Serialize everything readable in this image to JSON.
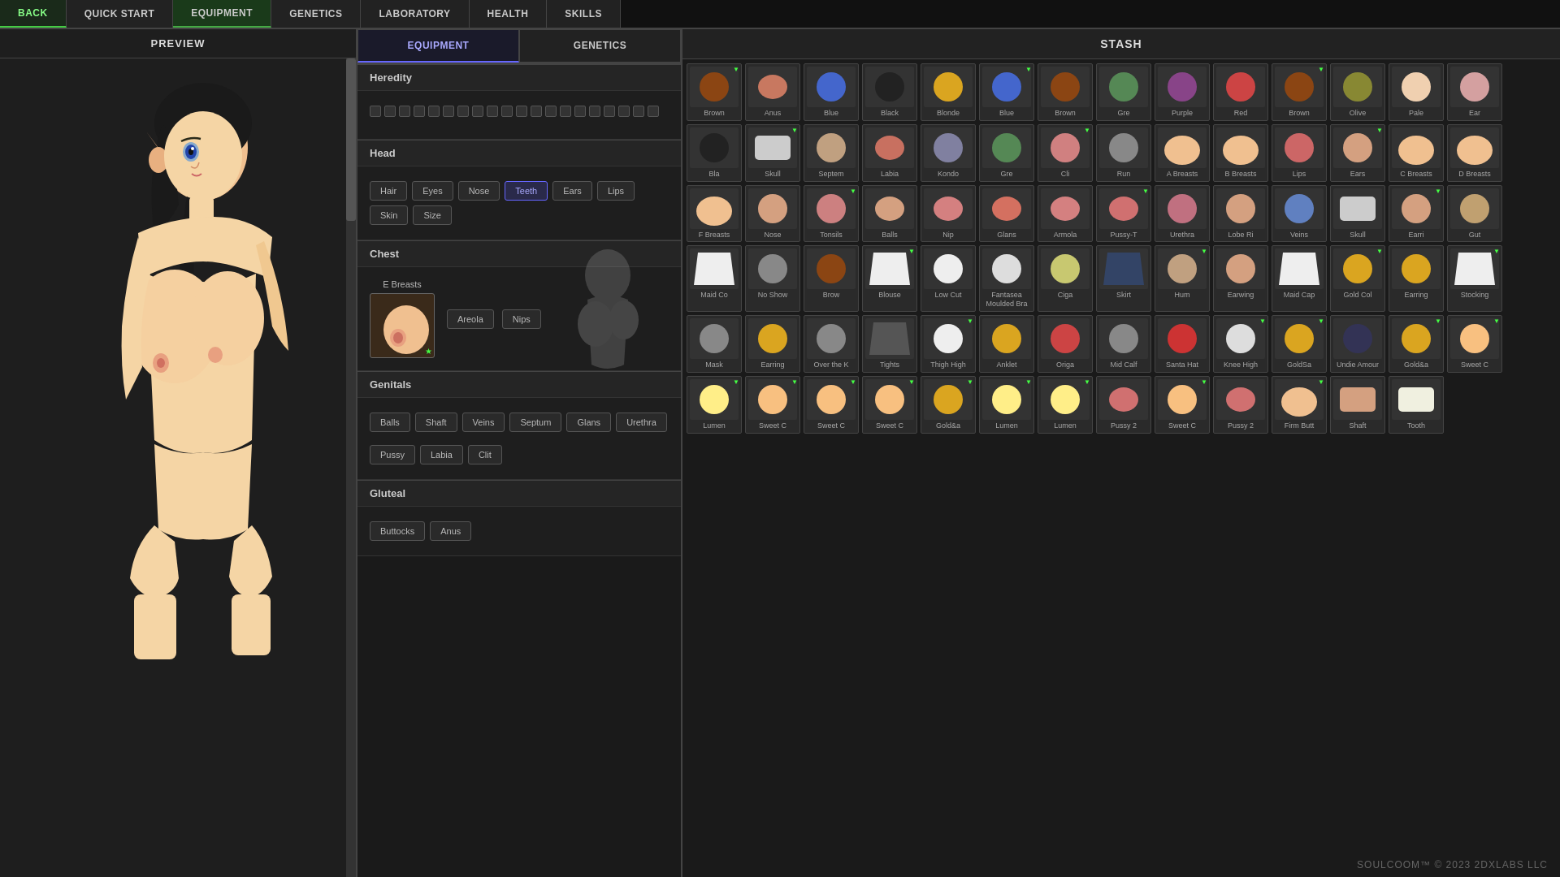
{
  "nav": {
    "back": "BACK",
    "items": [
      "QUICK START",
      "EQUIPMENT",
      "GENETICS",
      "LABORATORY",
      "HEALTH",
      "SKILLS"
    ],
    "active": "EQUIPMENT"
  },
  "preview": {
    "title": "PREVIEW"
  },
  "equipment": {
    "tab_equipment": "EQUIPMENT",
    "tab_genetics": "GENETICS",
    "sections": {
      "heredity": "Heredity",
      "head": "Head",
      "chest": "Chest",
      "genitals": "Genitals",
      "gluteal": "Gluteal"
    },
    "head_tags": [
      "Hair",
      "Eyes",
      "Nose",
      "Teeth",
      "Ears",
      "Lips",
      "Skin",
      "Size"
    ],
    "chest_item": "E Breasts",
    "chest_nips": [
      "Areola",
      "Nips"
    ],
    "genital_tags": [
      "Balls",
      "Shaft",
      "Veins",
      "Septum",
      "Glans",
      "Urethra",
      "Pussy",
      "Labia",
      "Clit"
    ],
    "gluteal_tags": [
      "Buttocks",
      "Anus"
    ]
  },
  "stash": {
    "title": "Stash",
    "items": [
      {
        "label": "Brown",
        "color": "#8B4513"
      },
      {
        "label": "Anus",
        "color": "#c87860"
      },
      {
        "label": "Blue",
        "color": "#4466cc"
      },
      {
        "label": "Black",
        "color": "#222"
      },
      {
        "label": "Blonde",
        "color": "#daa520"
      },
      {
        "label": "Blue",
        "color": "#4466cc"
      },
      {
        "label": "Brown",
        "color": "#8B4513"
      },
      {
        "label": "Gre",
        "color": "#558855"
      },
      {
        "label": "Purple",
        "color": "#884488"
      },
      {
        "label": "Red",
        "color": "#cc4444"
      },
      {
        "label": "Brown",
        "color": "#8B4513"
      },
      {
        "label": "Olive",
        "color": "#888833"
      },
      {
        "label": "Pale",
        "color": "#f0d0b0"
      },
      {
        "label": "Ear",
        "color": "#d4a0a0"
      },
      {
        "label": "Bla",
        "color": "#222"
      },
      {
        "label": "Skull",
        "color": "#ccc"
      },
      {
        "label": "Septem",
        "color": "#c0a080"
      },
      {
        "label": "Labia",
        "color": "#c87060"
      },
      {
        "label": "Kondo",
        "color": "#8080a0"
      },
      {
        "label": "Gre",
        "color": "#558855"
      },
      {
        "label": "Cli",
        "color": "#d08080"
      },
      {
        "label": "Run",
        "color": "#888"
      },
      {
        "label": "A Breasts",
        "color": "#f0c090"
      },
      {
        "label": "B Breasts",
        "color": "#f0c090"
      },
      {
        "label": "Lips",
        "color": "#cc6666"
      },
      {
        "label": "Ears",
        "color": "#d4a080"
      },
      {
        "label": "C Breasts",
        "color": "#f0c090"
      },
      {
        "label": "D Breasts",
        "color": "#f0c090"
      },
      {
        "label": "F Breasts",
        "color": "#f0c090"
      },
      {
        "label": "Nose",
        "color": "#d4a080"
      },
      {
        "label": "Tonsils",
        "color": "#cc8080"
      },
      {
        "label": "Balls",
        "color": "#d4a080"
      },
      {
        "label": "Nip",
        "color": "#d48080"
      },
      {
        "label": "Glans",
        "color": "#d47060"
      },
      {
        "label": "Armola",
        "color": "#d48080"
      },
      {
        "label": "Pussy-T",
        "color": "#d07070"
      },
      {
        "label": "Urethra",
        "color": "#c07080"
      },
      {
        "label": "Lobe Ri",
        "color": "#d4a080"
      },
      {
        "label": "Veins",
        "color": "#6080c0"
      },
      {
        "label": "Skull",
        "color": "#ccc"
      },
      {
        "label": "Earri",
        "color": "#d4a080"
      },
      {
        "label": "Gut",
        "color": "#c0a070"
      },
      {
        "label": "Maid Co",
        "color": "#eee"
      },
      {
        "label": "No Show",
        "color": "#888"
      },
      {
        "label": "Brow",
        "color": "#8B4513"
      },
      {
        "label": "Blouse",
        "color": "#eee"
      },
      {
        "label": "Low Cut",
        "color": "#eee"
      },
      {
        "label": "Fantasea Moulded Bra",
        "color": "#ddd"
      },
      {
        "label": "Ciga",
        "color": "#c8c870"
      },
      {
        "label": "Skirt",
        "color": "#334466"
      },
      {
        "label": "Hum",
        "color": "#c0a080"
      },
      {
        "label": "Earwing",
        "color": "#d4a080"
      },
      {
        "label": "Maid Cap",
        "color": "#eee"
      },
      {
        "label": "Gold Col",
        "color": "#daa520"
      },
      {
        "label": "Earring",
        "color": "#daa520"
      },
      {
        "label": "Stocking",
        "color": "#eee"
      },
      {
        "label": "Mask",
        "color": "#888"
      },
      {
        "label": "Earring",
        "color": "#daa520"
      },
      {
        "label": "Over the K",
        "color": "#888"
      },
      {
        "label": "Tights",
        "color": "#555"
      },
      {
        "label": "Thigh High",
        "color": "#eee"
      },
      {
        "label": "Anklet",
        "color": "#daa520"
      },
      {
        "label": "Origa",
        "color": "#cc4444"
      },
      {
        "label": "Mid Calf",
        "color": "#888"
      },
      {
        "label": "Santa Hat",
        "color": "#cc3333"
      },
      {
        "label": "Knee High",
        "color": "#ddd"
      },
      {
        "label": "GoldSa",
        "color": "#daa520"
      },
      {
        "label": "Undie Amour",
        "color": "#335"
      },
      {
        "label": "Gold&a",
        "color": "#daa520"
      },
      {
        "label": "Sweet C",
        "color": "#f8c080"
      },
      {
        "label": "Lumen",
        "color": "#ffee88"
      },
      {
        "label": "Sweet C",
        "color": "#f8c080"
      },
      {
        "label": "Sweet C",
        "color": "#f8c080"
      },
      {
        "label": "Sweet C",
        "color": "#f8c080"
      },
      {
        "label": "Gold&a",
        "color": "#daa520"
      },
      {
        "label": "Lumen",
        "color": "#ffee88"
      },
      {
        "label": "Lumen",
        "color": "#ffee88"
      },
      {
        "label": "Pussy 2",
        "color": "#d07070"
      },
      {
        "label": "Sweet C",
        "color": "#f8c080"
      },
      {
        "label": "Pussy 2",
        "color": "#d07070"
      },
      {
        "label": "Firm Butt",
        "color": "#f0c090"
      },
      {
        "label": "Shaft",
        "color": "#d4a080"
      },
      {
        "label": "Tooth",
        "color": "#f0f0e0"
      }
    ]
  },
  "footer": {
    "copyright": "SOULCOOM™ © 2023 2DXLABS LLC"
  }
}
